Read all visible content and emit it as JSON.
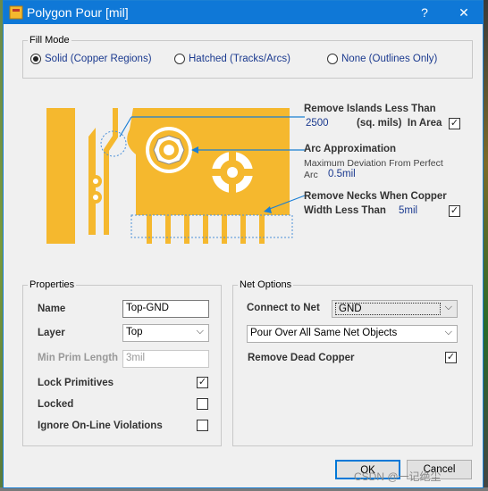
{
  "window": {
    "title": "Polygon Pour [mil]",
    "help_label": "?",
    "close_label": "✕"
  },
  "fill_mode": {
    "group_label": "Fill Mode",
    "options": [
      {
        "label": "Solid (Copper Regions)",
        "selected": true
      },
      {
        "label": "Hatched (Tracks/Arcs)",
        "selected": false
      },
      {
        "label": "None (Outlines Only)",
        "selected": false
      }
    ]
  },
  "remove_islands": {
    "label": "Remove Islands Less Than",
    "value": "2500",
    "unit": "(sq. mils)  In Area",
    "checked": true
  },
  "arc_approx": {
    "label": "Arc Approximation",
    "desc": "Maximum Deviation From Perfect",
    "arc_label": "Arc",
    "value": "0.5mil"
  },
  "remove_necks": {
    "label_line1": "Remove Necks When Copper",
    "label_line2": "Width Less Than",
    "value": "5mil",
    "checked": true
  },
  "properties": {
    "group_label": "Properties",
    "name_label": "Name",
    "name_value": "Top-GND",
    "layer_label": "Layer",
    "layer_value": "Top",
    "min_prim_label": "Min Prim Length",
    "min_prim_value": "3mil",
    "lock_primitives_label": "Lock Primitives",
    "lock_primitives_checked": true,
    "locked_label": "Locked",
    "locked_checked": false,
    "ignore_label": "Ignore On-Line Violations",
    "ignore_checked": false
  },
  "net_options": {
    "group_label": "Net Options",
    "connect_label": "Connect to Net",
    "connect_value": "GND",
    "pour_over_value": "Pour Over All Same Net Objects",
    "remove_dead_label": "Remove Dead Copper",
    "remove_dead_checked": true
  },
  "buttons": {
    "ok_label": "OK",
    "cancel_label": "Cancel"
  },
  "watermark": "CSDN @一记绝尘",
  "colors": {
    "titlebar": "#0f78d7",
    "copper": "#f5b82e",
    "accent_blue": "#1b7fd4"
  }
}
